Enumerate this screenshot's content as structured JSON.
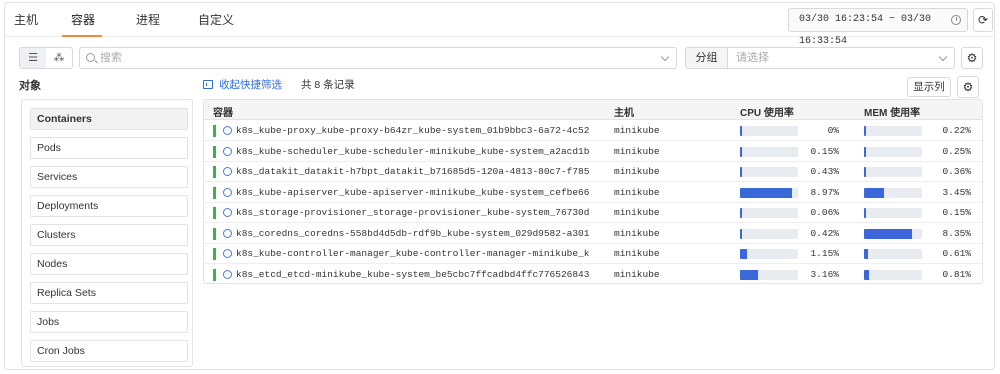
{
  "tabs": [
    "主机",
    "容器",
    "进程",
    "自定义"
  ],
  "active_tab": "容器",
  "time_range": "03/30 16:23:54 ~ 03/30 16:33:54",
  "search": {
    "placeholder": "搜索"
  },
  "group": {
    "label": "分组",
    "placeholder": "请选择"
  },
  "objects": {
    "title": "对象",
    "items": [
      "Containers",
      "Pods",
      "Services",
      "Deployments",
      "Clusters",
      "Nodes",
      "Replica Sets",
      "Jobs",
      "Cron Jobs"
    ],
    "active": "Containers"
  },
  "list": {
    "filter_link": "收起快捷筛选",
    "count_text": "共 8 条记录",
    "columns_button": "显示列",
    "columns": {
      "container": "容器",
      "host": "主机",
      "cpu": "CPU 使用率",
      "mem": "MEM 使用率"
    },
    "rows": [
      {
        "name": "k8s_kube-proxy_kube-proxy-b64zr_kube-system_01b9bbc3-6a72-4c52",
        "host": "minikube",
        "cpu": 0.0,
        "cpu_text": "0%",
        "mem": 0.22,
        "mem_text": "0.22%"
      },
      {
        "name": "k8s_kube-scheduler_kube-scheduler-minikube_kube-system_a2acd1b",
        "host": "minikube",
        "cpu": 0.15,
        "cpu_text": "0.15%",
        "mem": 0.25,
        "mem_text": "0.25%"
      },
      {
        "name": "k8s_datakit_datakit-h7bpt_datakit_b71685d5-120a-4813-80c7-f785",
        "host": "minikube",
        "cpu": 0.43,
        "cpu_text": "0.43%",
        "mem": 0.36,
        "mem_text": "0.36%"
      },
      {
        "name": "k8s_kube-apiserver_kube-apiserver-minikube_kube-system_cefbe66",
        "host": "minikube",
        "cpu": 8.97,
        "cpu_text": "8.97%",
        "mem": 3.45,
        "mem_text": "3.45%"
      },
      {
        "name": "k8s_storage-provisioner_storage-provisioner_kube-system_76730d",
        "host": "minikube",
        "cpu": 0.06,
        "cpu_text": "0.06%",
        "mem": 0.15,
        "mem_text": "0.15%"
      },
      {
        "name": "k8s_coredns_coredns-558bd4d5db-rdf9b_kube-system_029d9582-a301",
        "host": "minikube",
        "cpu": 0.42,
        "cpu_text": "0.42%",
        "mem": 8.35,
        "mem_text": "8.35%"
      },
      {
        "name": "k8s_kube-controller-manager_kube-controller-manager-minikube_k",
        "host": "minikube",
        "cpu": 1.15,
        "cpu_text": "1.15%",
        "mem": 0.61,
        "mem_text": "0.61%"
      },
      {
        "name": "k8s_etcd_etcd-minikube_kube-system_be5cbc7ffcadbd4ffc776526843",
        "host": "minikube",
        "cpu": 3.16,
        "cpu_text": "3.16%",
        "mem": 0.81,
        "mem_text": "0.81%"
      }
    ]
  },
  "colors": {
    "accent": "#f08a3c",
    "link": "#2f6fd6",
    "bar": "#3a68d8",
    "status": "#3cb34a"
  },
  "icons": [
    "clock-icon",
    "refresh-icon",
    "list-view-icon",
    "topology-view-icon",
    "search-icon",
    "chevron-down-icon",
    "gear-icon",
    "filter-icon",
    "pod-icon"
  ]
}
